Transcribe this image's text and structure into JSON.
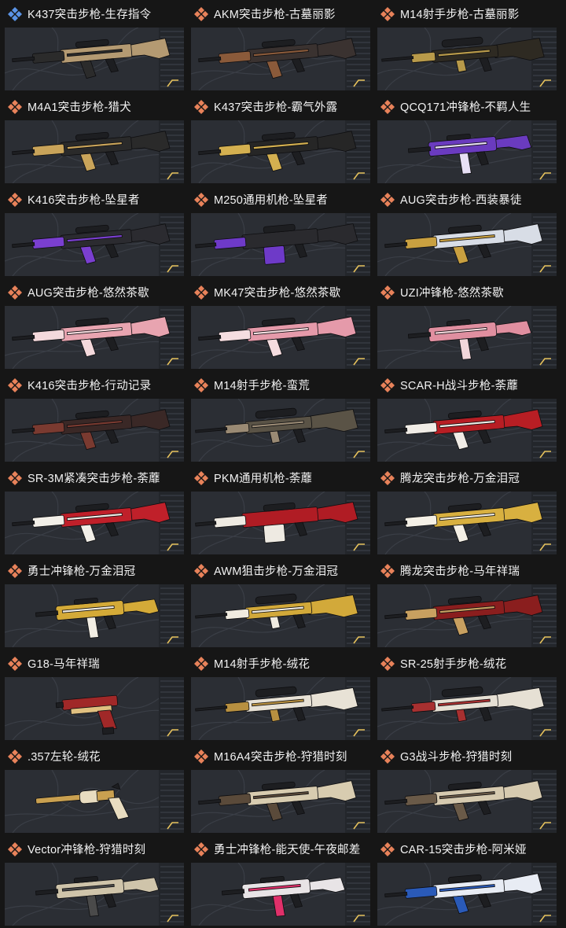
{
  "colors": {
    "page_bg": "#161616",
    "image_bg": "#2b2e34",
    "contour": "#3a3e46",
    "rack": "#23262b",
    "rack_line": "#31353c",
    "label": "#f2f2f2",
    "metal": "#1d1e21",
    "marker": "#e6c25c"
  },
  "items": [
    {
      "label": "K437突击步枪-生存指令",
      "icon": "diamond-cluster-icon",
      "tier_color": "#5a93e6",
      "body": "#b49a72",
      "accent": "#2b2b2b"
    },
    {
      "label": "AKM突击步枪-古墓丽影",
      "icon": "diamond-cluster-icon",
      "tier_color": "#e8825a",
      "body": "#3a3230",
      "accent": "#8a5a3a"
    },
    {
      "label": "M14射手步枪-古墓丽影",
      "icon": "diamond-cluster-icon",
      "tier_color": "#e8825a",
      "body": "#2e2a22",
      "accent": "#b89a4a"
    },
    {
      "label": "M4A1突击步枪-猎犬",
      "icon": "diamond-cluster-icon",
      "tier_color": "#e8825a",
      "body": "#2a2a2a",
      "accent": "#c9a45a"
    },
    {
      "label": "K437突击步枪-霸气外露",
      "icon": "diamond-cluster-icon",
      "tier_color": "#e8825a",
      "body": "#262626",
      "accent": "#d4b050"
    },
    {
      "label": "QCQ171冲锋枪-不羁人生",
      "icon": "diamond-cluster-icon",
      "tier_color": "#e8825a",
      "body": "#6a3bbf",
      "accent": "#e8e0f5"
    },
    {
      "label": "K416突击步枪-坠星者",
      "icon": "diamond-cluster-icon",
      "tier_color": "#e8825a",
      "body": "#2b2b30",
      "accent": "#7a3fd0"
    },
    {
      "label": "M250通用机枪-坠星者",
      "icon": "diamond-cluster-icon",
      "tier_color": "#e8825a",
      "body": "#2a2a2e",
      "accent": "#6e3ac8"
    },
    {
      "label": "AUG突击步枪-西装暴徒",
      "icon": "diamond-cluster-icon",
      "tier_color": "#e8825a",
      "body": "#d8dde6",
      "accent": "#c9a040"
    },
    {
      "label": "AUG突击步枪-悠然茶歇",
      "icon": "diamond-cluster-icon",
      "tier_color": "#e8825a",
      "body": "#e8a4b0",
      "accent": "#f4d9dc"
    },
    {
      "label": "MK47突击步枪-悠然茶歇",
      "icon": "diamond-cluster-icon",
      "tier_color": "#e8825a",
      "body": "#e59aaa",
      "accent": "#f5dde0"
    },
    {
      "label": "UZI冲锋枪-悠然茶歇",
      "icon": "diamond-cluster-icon",
      "tier_color": "#e8825a",
      "body": "#e08fa0",
      "accent": "#f2d6da"
    },
    {
      "label": "K416突击步枪-行动记录",
      "icon": "diamond-cluster-icon",
      "tier_color": "#e8825a",
      "body": "#3a2826",
      "accent": "#7a3a30"
    },
    {
      "label": "M14射手步枪-蛮荒",
      "icon": "diamond-cluster-icon",
      "tier_color": "#e8825a",
      "body": "#5a5346",
      "accent": "#9a8a74"
    },
    {
      "label": "SCAR-H战斗步枪-荼蘼",
      "icon": "diamond-cluster-icon",
      "tier_color": "#e8825a",
      "body": "#b81e24",
      "accent": "#f0ece6"
    },
    {
      "label": "SR-3M紧凑突击步枪-荼蘼",
      "icon": "diamond-cluster-icon",
      "tier_color": "#e8825a",
      "body": "#c0202a",
      "accent": "#f2efe8"
    },
    {
      "label": "PKM通用机枪-荼蘼",
      "icon": "diamond-cluster-icon",
      "tier_color": "#e8825a",
      "body": "#b01c24",
      "accent": "#eeeae2"
    },
    {
      "label": "腾龙突击步枪-万金泪冠",
      "icon": "diamond-cluster-icon",
      "tier_color": "#e8825a",
      "body": "#d8b040",
      "accent": "#f4f0e6"
    },
    {
      "label": "勇士冲锋枪-万金泪冠",
      "icon": "diamond-cluster-icon",
      "tier_color": "#e8825a",
      "body": "#d4aa38",
      "accent": "#f2eee4"
    },
    {
      "label": "AWM狙击步枪-万金泪冠",
      "icon": "diamond-cluster-icon",
      "tier_color": "#e8825a",
      "body": "#d2a93a",
      "accent": "#f0ebe0"
    },
    {
      "label": "腾龙突击步枪-马年祥瑞",
      "icon": "diamond-cluster-icon",
      "tier_color": "#e8825a",
      "body": "#8a1e1e",
      "accent": "#c8a060"
    },
    {
      "label": "G18-马年祥瑞",
      "icon": "diamond-cluster-icon",
      "tier_color": "#e8825a",
      "body": "#a02828",
      "accent": "#e0c080"
    },
    {
      "label": "M14射手步枪-绒花",
      "icon": "diamond-cluster-icon",
      "tier_color": "#e8825a",
      "body": "#e8e2d6",
      "accent": "#b89040"
    },
    {
      "label": "SR-25射手步枪-绒花",
      "icon": "diamond-cluster-icon",
      "tier_color": "#e8825a",
      "body": "#e6e0d4",
      "accent": "#a83030"
    },
    {
      "label": ".357左轮-绒花",
      "icon": "diamond-cluster-icon",
      "tier_color": "#e8825a",
      "body": "#c9a050",
      "accent": "#e8dcc0"
    },
    {
      "label": "M16A4突击步枪-狩猎时刻",
      "icon": "diamond-cluster-icon",
      "tier_color": "#e8825a",
      "body": "#d8ccb0",
      "accent": "#5a4a3a"
    },
    {
      "label": "G3战斗步枪-狩猎时刻",
      "icon": "diamond-cluster-icon",
      "tier_color": "#e8825a",
      "body": "#d6cab0",
      "accent": "#6a5a48"
    },
    {
      "label": "Vector冲锋枪-狩猎时刻",
      "icon": "diamond-cluster-icon",
      "tier_color": "#e8825a",
      "body": "#cfc4aa",
      "accent": "#4a4a4a"
    },
    {
      "label": "勇士冲锋枪-能天使-午夜邮差",
      "icon": "diamond-cluster-icon",
      "tier_color": "#e8825a",
      "body": "#e8e4e6",
      "accent": "#e0306a"
    },
    {
      "label": "CAR-15突击步枪-阿米娅",
      "icon": "diamond-cluster-icon",
      "tier_color": "#e8825a",
      "body": "#e8ecf4",
      "accent": "#2a5ab8"
    }
  ]
}
